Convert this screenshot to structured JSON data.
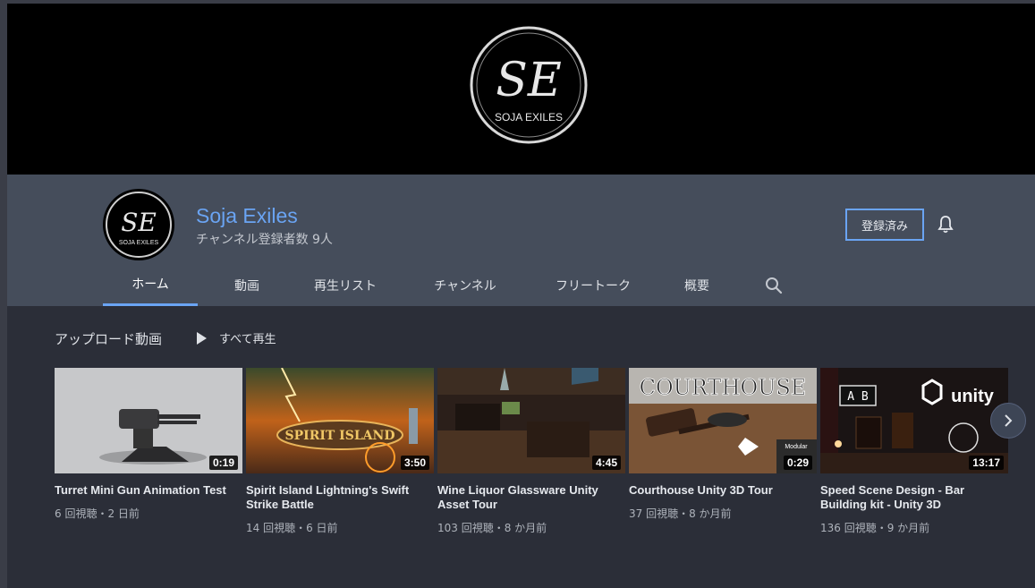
{
  "banner": {
    "logo_monogram": "SE",
    "logo_text": "SOJA EXILES"
  },
  "channel": {
    "name": "Soja Exiles",
    "subscriber_count": "チャンネル登録者数 9人",
    "avatar_monogram": "SE",
    "avatar_text": "SOJA EXILES",
    "subscribe_label": "登録済み",
    "bell_icon": "bell-icon"
  },
  "tabs": [
    {
      "label": "ホーム",
      "active": true
    },
    {
      "label": "動画",
      "active": false
    },
    {
      "label": "再生リスト",
      "active": false
    },
    {
      "label": "チャンネル",
      "active": false
    },
    {
      "label": "フリートーク",
      "active": false
    },
    {
      "label": "概要",
      "active": false
    }
  ],
  "section": {
    "title": "アップロード動画",
    "play_all_label": "すべて再生"
  },
  "videos": [
    {
      "title": "Turret Mini Gun Animation Test",
      "duration": "0:19",
      "meta": "6 回視聴・2 日前"
    },
    {
      "title": "Spirit Island Lightning's Swift Strike Battle",
      "duration": "3:50",
      "meta": "14 回視聴・6 日前"
    },
    {
      "title": "Wine Liquor Glassware Unity Asset Tour",
      "duration": "4:45",
      "meta": "103 回視聴・8 か月前"
    },
    {
      "title": "Courthouse Unity 3D Tour",
      "duration": "0:29",
      "meta": "37 回視聴・8 か月前"
    },
    {
      "title": "Speed Scene Design - Bar Building kit - Unity 3D",
      "duration": "13:17",
      "meta": "136 回視聴・9 か月前"
    }
  ],
  "thumb_text": {
    "spirit_island": "SPIRIT ISLAND",
    "courthouse": "COURTHOUSE",
    "modular": "Modular",
    "unity": "unity",
    "ab": "A B"
  },
  "colors": {
    "accent": "#6aa4f3",
    "header_bg": "#454d5b",
    "page_bg": "#2b2e38"
  }
}
